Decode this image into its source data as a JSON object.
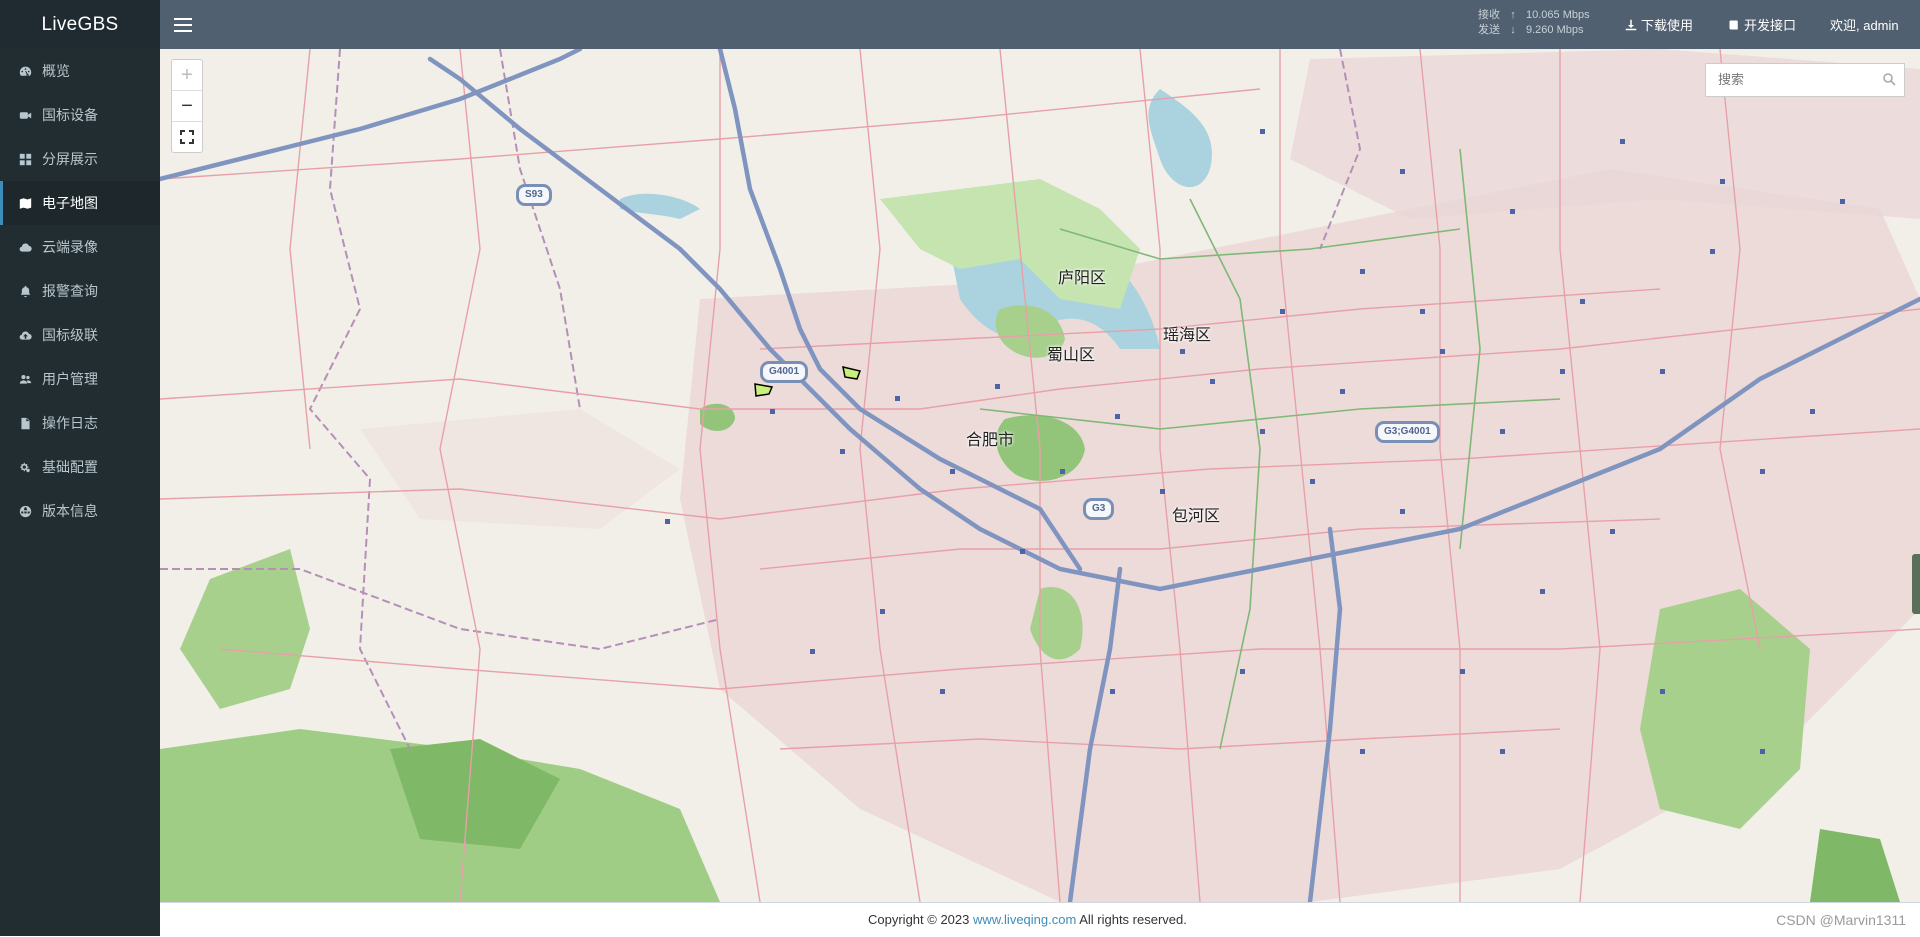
{
  "app": {
    "logo": "LiveGBS"
  },
  "sidebar": {
    "items": [
      {
        "label": "概览",
        "icon": "dashboard-icon"
      },
      {
        "label": "国标设备",
        "icon": "video-camera-icon"
      },
      {
        "label": "分屏展示",
        "icon": "grid-icon"
      },
      {
        "label": "电子地图",
        "icon": "map-icon",
        "active": true
      },
      {
        "label": "云端录像",
        "icon": "cloud-icon"
      },
      {
        "label": "报警查询",
        "icon": "bell-icon"
      },
      {
        "label": "国标级联",
        "icon": "cloud-upload-icon"
      },
      {
        "label": "用户管理",
        "icon": "users-icon"
      },
      {
        "label": "操作日志",
        "icon": "file-icon"
      },
      {
        "label": "基础配置",
        "icon": "cogs-icon"
      },
      {
        "label": "版本信息",
        "icon": "globe-icon"
      }
    ]
  },
  "header": {
    "receive_label": "接收",
    "receive_value": "10.065 Mbps",
    "send_label": "发送",
    "send_value": "9.260 Mbps",
    "download_label": "下载使用",
    "api_label": "开发接口",
    "welcome": "欢迎, admin"
  },
  "map": {
    "zoom_in": "+",
    "zoom_out": "−",
    "search_placeholder": "搜索",
    "labels": {
      "city": "合肥市",
      "district1": "庐阳区",
      "district2": "瑶海区",
      "district3": "蜀山区",
      "district4": "包河区",
      "shield1": "S93",
      "shield2": "G4001",
      "shield3": "G3;G4001",
      "shield4": "G3"
    }
  },
  "footer": {
    "copy_prefix": "Copyright © 2023 ",
    "link": "www.liveqing.com",
    "copy_suffix": " All rights reserved.",
    "watermark": "CSDN @Marvin1311"
  },
  "colors": {
    "sidebar_bg": "#222d32",
    "header_bg": "#506070",
    "accent": "#3c8dbc",
    "map_land": "#f2efe9",
    "map_green": "#a8d08d",
    "map_water": "#aad3df",
    "map_road": "#e8a0a8",
    "map_highway": "#8094c0"
  }
}
